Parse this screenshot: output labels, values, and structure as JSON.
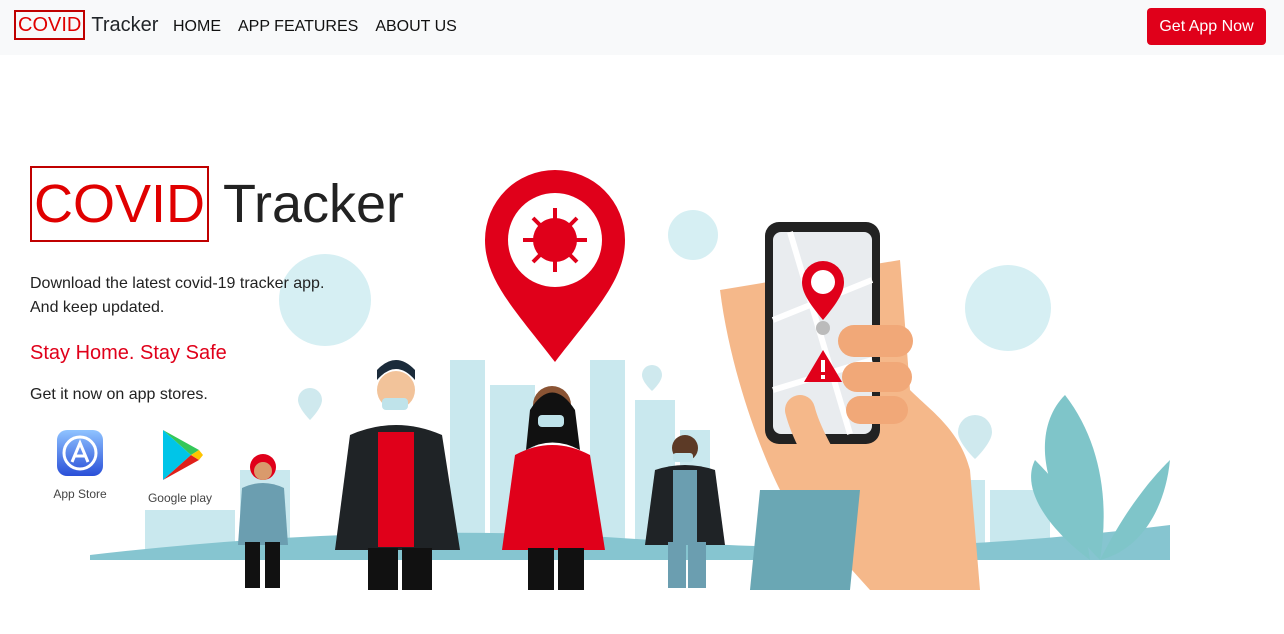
{
  "navbar": {
    "brand_highlight": "COVID",
    "brand_rest": "Tracker",
    "links": [
      "HOME",
      "APP FEATURES",
      "ABOUT US"
    ],
    "cta": "Get App Now"
  },
  "hero": {
    "title_highlight": "COVID",
    "title_rest": "Tracker",
    "desc_line1": "Download the latest covid-19 tracker app.",
    "desc_line2": "And keep updated.",
    "slogan": "Stay Home. Stay Safe",
    "get_it": "Get it now on app stores."
  },
  "stores": {
    "appstore_label": "App Store",
    "google_label": "Google play"
  },
  "colors": {
    "accent": "#e0001a",
    "navbar_bg": "#f8f9fa",
    "skyline": "#a8d8e2"
  }
}
